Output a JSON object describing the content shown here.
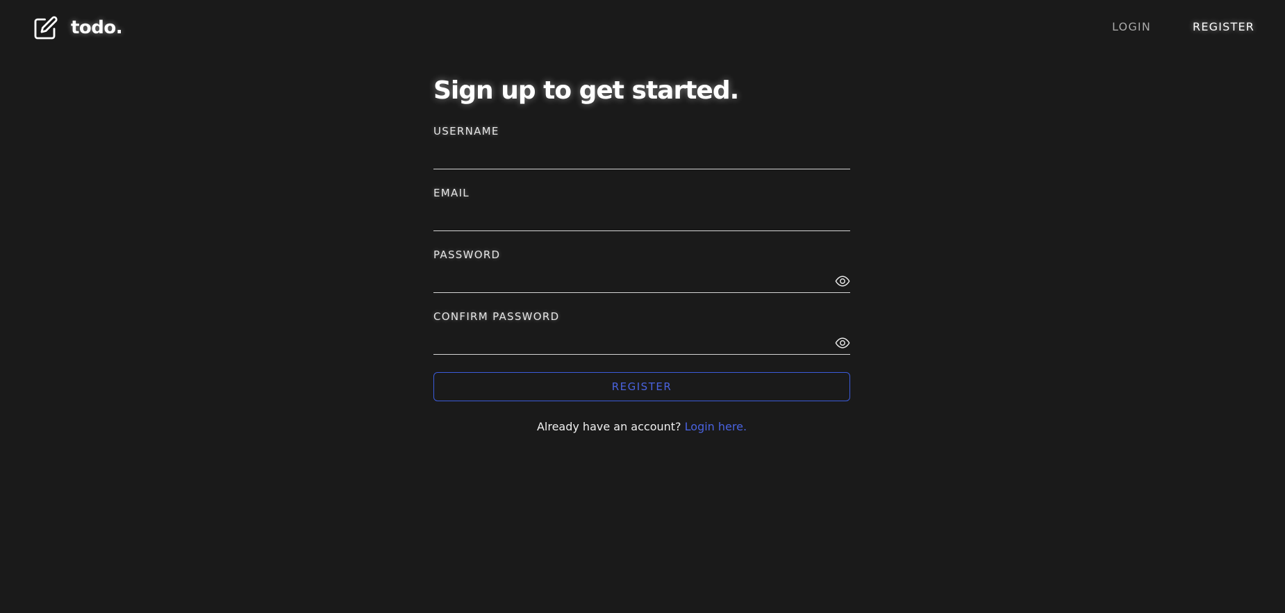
{
  "nav": {
    "brand_text": "todo.",
    "brand_icon": "pencil-square-icon",
    "links": [
      {
        "label": "LOGIN",
        "active": false
      },
      {
        "label": "REGISTER",
        "active": true
      }
    ]
  },
  "form": {
    "title": "Sign up to get started.",
    "fields": [
      {
        "label": "USERNAME",
        "value": "",
        "type": "text"
      },
      {
        "label": "EMAIL",
        "value": "",
        "type": "email"
      },
      {
        "label": "PASSWORD",
        "value": "",
        "type": "password",
        "toggle_icon": "eye-icon"
      },
      {
        "label": "CONFIRM PASSWORD",
        "value": "",
        "type": "password",
        "toggle_icon": "eye-icon"
      }
    ],
    "submit_label": "REGISTER",
    "footer_text": "Already have an account?",
    "footer_link": "Login here."
  },
  "colors": {
    "background": "#1a1a1a",
    "accent": "#3b5bdb",
    "text": "#ffffff",
    "muted": "#a9a9a9"
  }
}
